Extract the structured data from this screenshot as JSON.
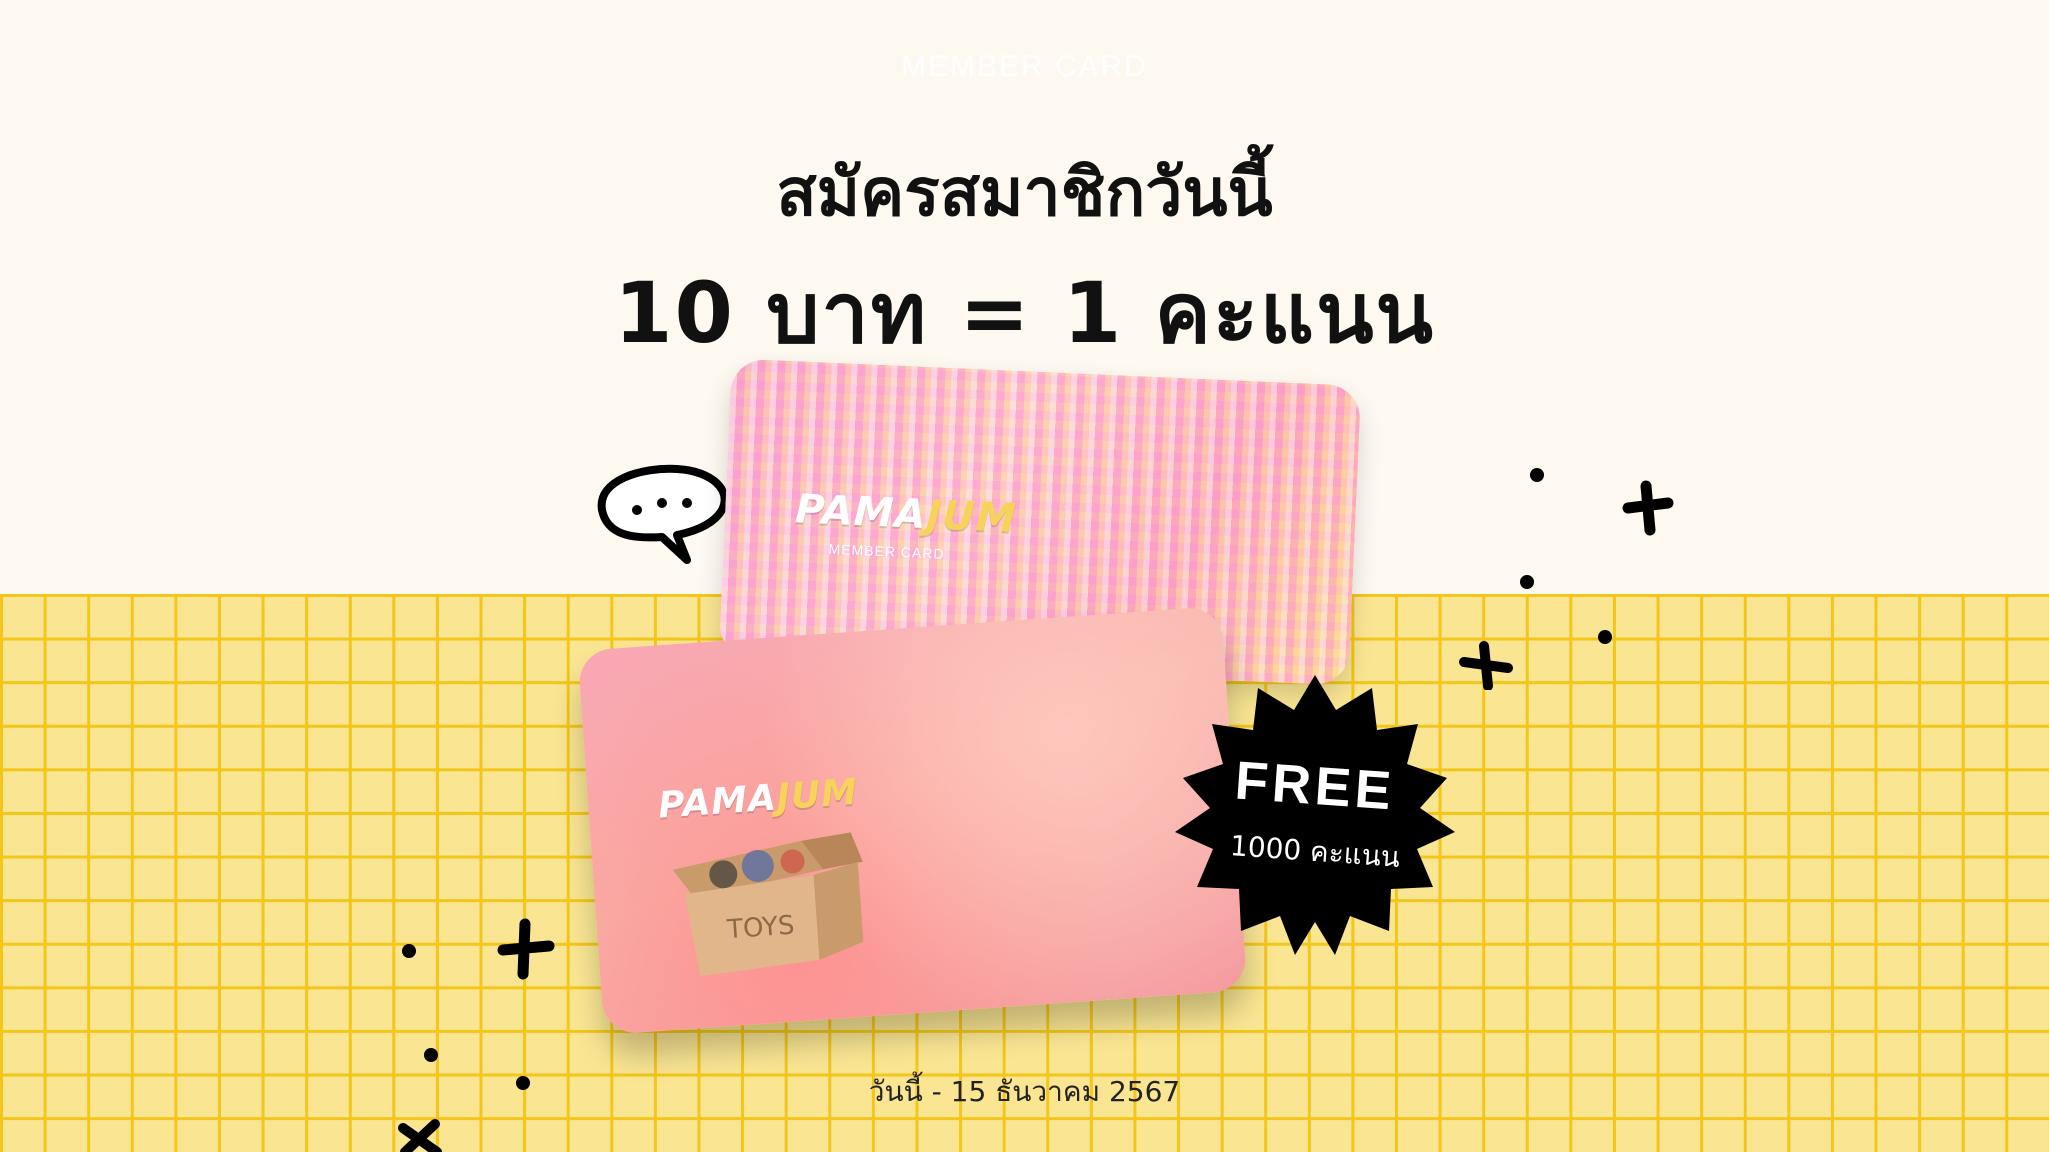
{
  "top_label": "MEMBER CARD",
  "headline": "สมัครสมาชิกวันนี้",
  "subhead": "10 บาท = 1 คะแนน",
  "card_back": {
    "brand_left": "PAMA",
    "brand_right": "JUM",
    "subtitle": "MEMBER CARD"
  },
  "card_front": {
    "brand_left": "PAMA",
    "brand_right": "JUM",
    "box_label": "TOYS"
  },
  "badge": {
    "free": "FREE",
    "points": "1000 คะแนน"
  },
  "date": "วันนี้ - 15 ธันวาคม 2567",
  "colors": {
    "background": "#fdf9f1",
    "grid_fill": "#f9e592",
    "grid_line": "#f3c619",
    "badge": "#000000"
  }
}
